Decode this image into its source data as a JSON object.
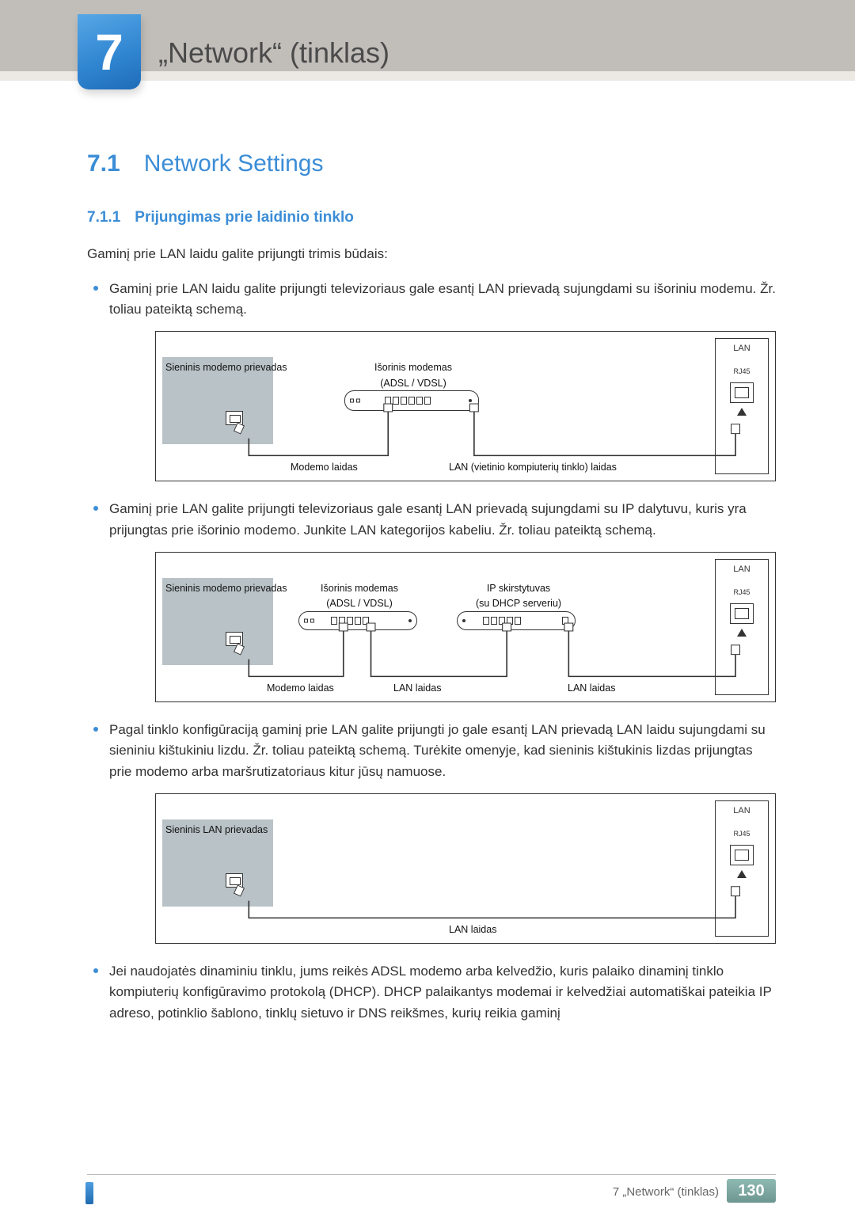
{
  "chapter": {
    "number": "7",
    "title": "„Network“ (tinklas)"
  },
  "section": {
    "number": "7.1",
    "title": "Network Settings"
  },
  "subsection": {
    "number": "7.1.1",
    "title": "Prijungimas prie laidinio tinklo"
  },
  "intro": "Gaminį prie LAN laidu galite prijungti trimis būdais:",
  "bullets": {
    "b1": "Gaminį prie LAN laidu galite prijungti televizoriaus gale esantį LAN prievadą sujungdami su išoriniu modemu. Žr. toliau pateiktą schemą.",
    "b2": "Gaminį prie LAN galite prijungti televizoriaus gale esantį LAN prievadą sujungdami su IP dalytuvu, kuris yra prijungtas prie išorinio modemo. Junkite LAN kategorijos kabeliu. Žr. toliau pateiktą schemą.",
    "b3": "Pagal tinklo konfigūraciją gaminį prie LAN galite prijungti jo gale esantį LAN prievadą LAN laidu sujungdami su sieniniu kištukiniu lizdu. Žr. toliau pateiktą schemą. Turėkite omenyje, kad sieninis kištukinis lizdas prijungtas prie modemo arba maršrutizatoriaus kitur jūsų namuose.",
    "b4": "Jei naudojatės dinaminiu tinklu, jums reikės ADSL modemo arba kelvedžio, kuris palaiko dinaminį tinklo kompiuterių konfigūravimo protokolą (DHCP). DHCP palaikantys modemai ir kelvedžiai automatiškai pateikia IP adreso, potinklio šablono, tinklų sietuvo ir DNS reikšmes, kurių reikia gaminį"
  },
  "diagram_labels": {
    "wall_modem_port": "Sieninis modemo prievadas",
    "wall_lan_port": "Sieninis LAN prievadas",
    "external_modem": "Išorinis modemas",
    "adsl_vdsl": "(ADSL / VDSL)",
    "ip_splitter": "IP skirstytuvas",
    "dhcp_server": "(su DHCP serveriu)",
    "modem_cable": "Modemo laidas",
    "lan_cable": "LAN laidas",
    "lan_cable_long": "LAN (vietinio kompiuterių tinklo) laidas",
    "lan": "LAN",
    "rj45": "RJ45"
  },
  "footer": {
    "text": "7 „Network“ (tinklas)",
    "page": "130"
  }
}
